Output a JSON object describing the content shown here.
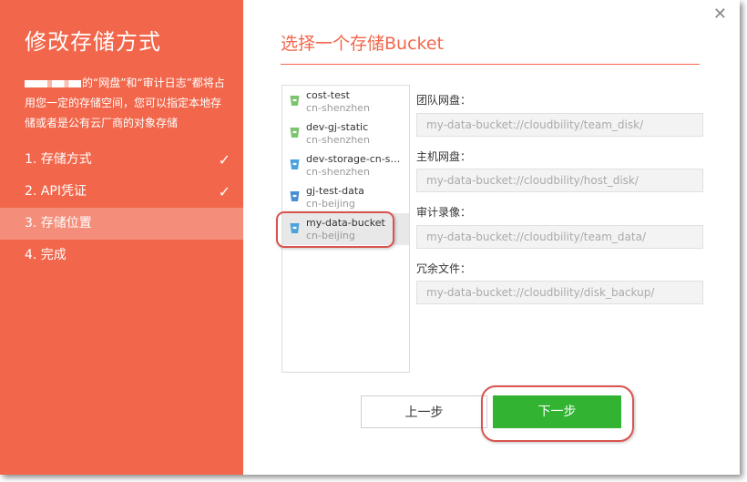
{
  "left_panel": {
    "title": "修改存储方式",
    "description": "的“网盘”和“审计日志”都将占用您一定的存储空间，您可以指定本地存储或者是公有云厂商的对象存储",
    "steps": [
      {
        "label": "1. 存储方式",
        "done": true
      },
      {
        "label": "2. API凭证",
        "done": true
      },
      {
        "label": "3. 存储位置",
        "active": true
      },
      {
        "label": "4. 完成"
      }
    ],
    "check_glyph": "✓"
  },
  "main": {
    "title": "选择一个存储Bucket",
    "close_glyph": "✕",
    "buckets": [
      {
        "name": "cost-test",
        "region": "cn-shenzhen",
        "icon": "bucket-icon",
        "color": "#7cc36f"
      },
      {
        "name": "dev-gj-static",
        "region": "cn-shenzhen",
        "icon": "bucket-icon",
        "color": "#7cc36f"
      },
      {
        "name": "dev-storage-cn-she...",
        "region": "cn-shenzhen",
        "icon": "bucket-icon",
        "color": "#4aa3df"
      },
      {
        "name": "gj-test-data",
        "region": "cn-beijing",
        "icon": "bucket-icon",
        "color": "#4a8fd6"
      },
      {
        "name": "my-data-bucket",
        "region": "cn-beijing",
        "icon": "bucket-icon",
        "color": "#4aa3df",
        "selected": true
      }
    ],
    "fields": [
      {
        "label": "团队网盘：",
        "value": "my-data-bucket://cloudbility/team_disk/"
      },
      {
        "label": "主机网盘：",
        "value": "my-data-bucket://cloudbility/host_disk/"
      },
      {
        "label": "审计录像：",
        "value": "my-data-bucket://cloudbility/team_data/"
      },
      {
        "label": "冗余文件：",
        "value": "my-data-bucket://cloudbility/disk_backup/"
      }
    ],
    "prev_button": "上一步",
    "next_button": "下一步"
  },
  "colors": {
    "accent": "#f2674b",
    "active_step": "#f48d79",
    "next_button": "#32b332",
    "highlight": "#d9534f"
  }
}
